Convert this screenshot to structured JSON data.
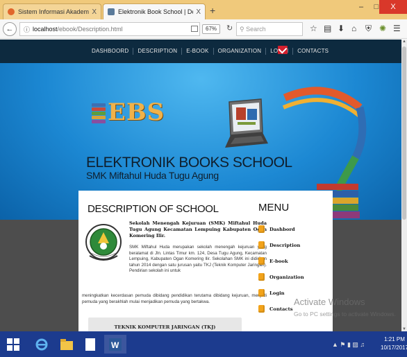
{
  "browser": {
    "tabs": [
      {
        "title": "Sistem Informasi Akademik",
        "active": false
      },
      {
        "title": "Elektronik Book School | De",
        "active": true
      }
    ],
    "new_tab_symbol": "+",
    "close_tab_symbol": "X",
    "url_host": "localhost",
    "url_path": "/ebook/Description.html",
    "zoom_level": "67%",
    "search_placeholder": "Search",
    "window_buttons": {
      "minimize": "–",
      "maximize": "□",
      "close": "X"
    }
  },
  "site": {
    "nav": [
      "DASHBOORD",
      "DESCRIPTION",
      "E-BOOK",
      "ORGANIZATION",
      "LOGIN",
      "CONTACTS"
    ],
    "logo_text": "EBS",
    "banner_title": "ELEKTRONIK BOOKS SCHOOL",
    "banner_subtitle": "SMK Miftahul Huda Tugu Agung",
    "description": {
      "title": "DESCRIPTION OF SCHOOL",
      "lead": "Sekolah Menengah Kejuruan (SMK) Miftahul Huda Tugu Agung Kecamatan Lempuing Kabupaten Ogan Komering Ilir.",
      "body_1": "SMK Miftahul Huda merupakan sekolah menengah kejuruan yang beralamat di Jln. Lintas Timur km. 124, Desa Tugu Agung, Kecamatan Lempuing, Kabupaten Ogan Komering Ilir. Sekolahan SMK ini didirikan tahun 2014 dengan satu jurusan yaitu TKJ (Teknik Komputer Jaringan). Pendirian sekolah ini untuk",
      "body_2": "meningkatkan kecerdasan pemuda dibidang pendidikan terutama dibidang kejuruan, menjadi pemuda yang berakhlah mulai menjadikan pemuda yang bertakwa.",
      "major_box": "TEKNIK KOMPUTER JARINGAN (TKJ)"
    },
    "menu": {
      "title": "MENU",
      "items": [
        "Dashbord",
        "Description",
        "E-book",
        "Organization",
        "Login",
        "Contacts"
      ]
    }
  },
  "watermark": {
    "title": "Activate Windows",
    "subtitle": "Go to PC settings to activate Windows."
  },
  "taskbar": {
    "time": "1:21 PM",
    "date": "10/17/2017"
  },
  "colors": {
    "tabbar": "#f0c97b",
    "site_nav": "#0d2a3f",
    "banner_blue": "#1c88d3",
    "menu_bullet": "#f2a31b",
    "taskbar": "#1c3b8e",
    "mail_icon": "#d21f2e"
  }
}
